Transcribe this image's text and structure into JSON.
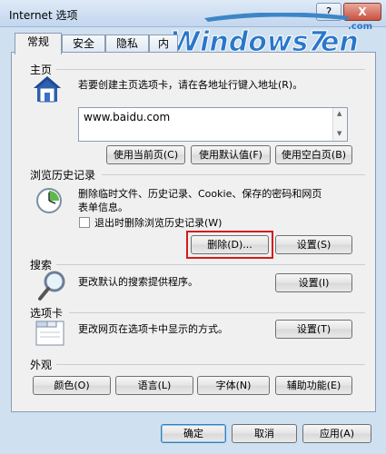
{
  "window": {
    "title": "Internet 选项",
    "help": "?",
    "close": "X"
  },
  "watermark": "Windows7en .com",
  "tabs": [
    {
      "label": "常规"
    },
    {
      "label": "安全"
    },
    {
      "label": "隐私"
    },
    {
      "label": "内"
    }
  ],
  "home": {
    "heading": "主页",
    "description": "若要创建主页选项卡，请在各地址行键入地址(R)。",
    "url": "www.baidu.com",
    "buttons": {
      "current": "使用当前页(C)",
      "default": "使用默认值(F)",
      "blank": "使用空白页(B)"
    }
  },
  "history": {
    "heading": "浏览历史记录",
    "description_line1": "删除临时文件、历史记录、Cookie、保存的密码和网页",
    "description_line2": "表单信息。",
    "checkbox_label": "退出时删除浏览历史记录(W)",
    "buttons": {
      "delete": "删除(D)...",
      "settings": "设置(S)"
    }
  },
  "search": {
    "heading": "搜索",
    "description": "更改默认的搜索提供程序。",
    "settings": "设置(I)"
  },
  "tabs_section": {
    "heading": "选项卡",
    "description": "更改网页在选项卡中显示的方式。",
    "settings": "设置(T)"
  },
  "appearance": {
    "heading": "外观",
    "buttons": {
      "colors": "颜色(O)",
      "languages": "语言(L)",
      "fonts": "字体(N)",
      "accessibility": "辅助功能(E)"
    }
  },
  "footer": {
    "ok": "确定",
    "cancel": "取消",
    "apply": "应用(A)"
  }
}
